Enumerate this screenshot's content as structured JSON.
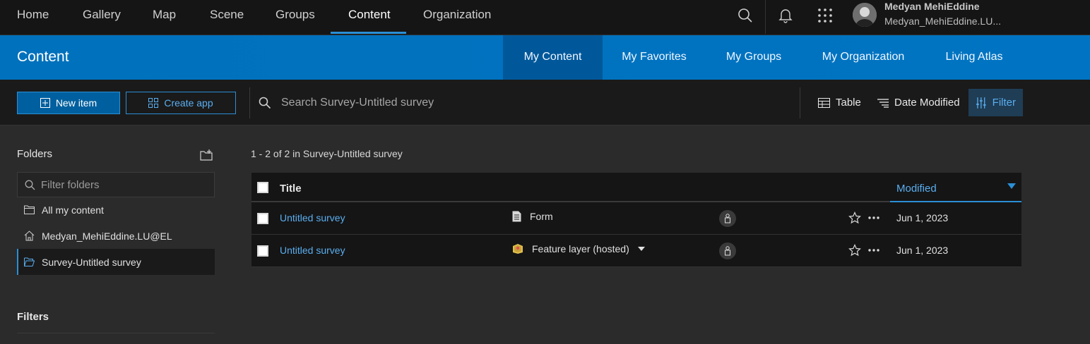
{
  "topnav": {
    "items": [
      "Home",
      "Gallery",
      "Map",
      "Scene",
      "Groups",
      "Content",
      "Organization"
    ],
    "active": "Content",
    "user_name": "Medyan MehiEddine",
    "user_id": "Medyan_MehiEddine.LU..."
  },
  "header": {
    "title": "Content",
    "tabs": [
      "My Content",
      "My Favorites",
      "My Groups",
      "My Organization",
      "Living Atlas"
    ],
    "active_tab": "My Content"
  },
  "toolbar": {
    "new_item": "New item",
    "create_app": "Create app",
    "search_placeholder": "Search Survey-Untitled survey",
    "table": "Table",
    "date_modified": "Date Modified",
    "filter": "Filter"
  },
  "sidebar": {
    "folders_heading": "Folders",
    "filter_placeholder": "Filter folders",
    "folders": [
      "All my content",
      "Medyan_MehiEddine.LU@EL",
      "Survey-Untitled survey"
    ],
    "selected_folder": "Survey-Untitled survey",
    "filters_heading": "Filters"
  },
  "main": {
    "count_text": "1 - 2 of 2 in Survey-Untitled survey",
    "columns": {
      "title": "Title",
      "modified": "Modified"
    },
    "rows": [
      {
        "title": "Untitled survey",
        "type": "Form",
        "modified": "Jun 1, 2023"
      },
      {
        "title": "Untitled survey",
        "type": "Feature layer (hosted)",
        "modified": "Jun 1, 2023"
      }
    ]
  },
  "colors": {
    "accent": "#2b8fd6",
    "band": "#0071bc",
    "link": "#5aaef0"
  }
}
